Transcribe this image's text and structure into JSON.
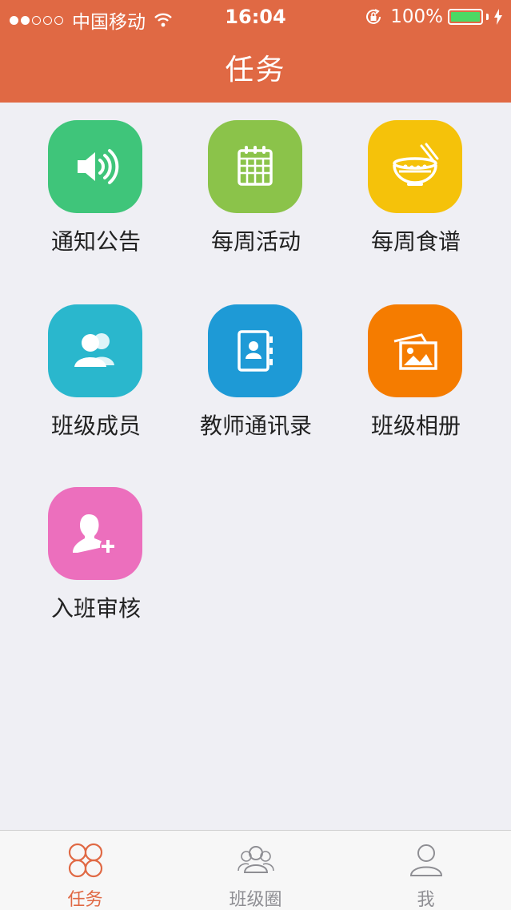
{
  "status_bar": {
    "carrier": "中国移动",
    "time": "16:04",
    "battery": "100%"
  },
  "nav": {
    "title": "任务"
  },
  "tiles": [
    {
      "label": "通知公告",
      "icon": "speaker-icon",
      "color": "#3fc57a"
    },
    {
      "label": "每周活动",
      "icon": "calendar-icon",
      "color": "#8bc34a"
    },
    {
      "label": "每周食谱",
      "icon": "food-bowl-icon",
      "color": "#f5c20a"
    },
    {
      "label": "班级成员",
      "icon": "members-icon",
      "color": "#2ab7cd"
    },
    {
      "label": "教师通讯录",
      "icon": "contact-book-icon",
      "color": "#1e9ad6"
    },
    {
      "label": "班级相册",
      "icon": "photo-album-icon",
      "color": "#f57c00"
    },
    {
      "label": "入班审核",
      "icon": "add-user-icon",
      "color": "#ec6fbd"
    }
  ],
  "tabbar": {
    "items": [
      {
        "label": "任务",
        "icon": "clover-icon",
        "active": true
      },
      {
        "label": "班级圈",
        "icon": "group-icon",
        "active": false
      },
      {
        "label": "我",
        "icon": "person-icon",
        "active": false
      }
    ],
    "active_color": "#e06944",
    "inactive_color": "#8e8e93"
  }
}
